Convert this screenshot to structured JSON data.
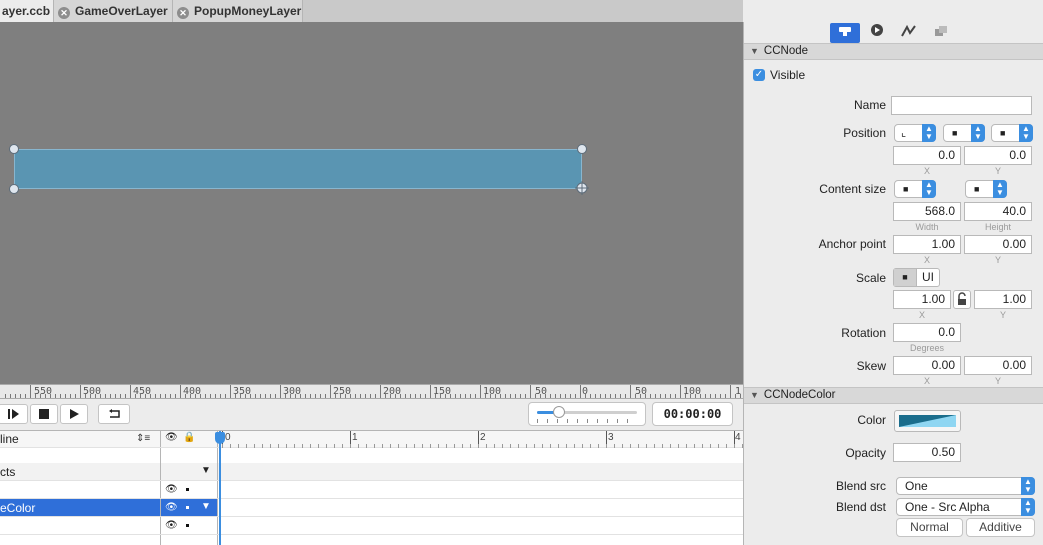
{
  "tabs": [
    {
      "label": "ayer.ccb",
      "active": true
    },
    {
      "label": "GameOverLayer",
      "active": false
    },
    {
      "label": "PopupMoneyLayer",
      "active": false
    }
  ],
  "ruler": {
    "labels": [
      "550",
      "500",
      "450",
      "400",
      "350",
      "300",
      "250",
      "200",
      "150",
      "100",
      "50",
      "0",
      "50",
      "100",
      "1"
    ]
  },
  "playback": {
    "timecode": "00:00:00",
    "zoom_fraction": 0.22
  },
  "timeline": {
    "header_label": "line",
    "ticks": [
      "0",
      "1",
      "2",
      "3",
      "4"
    ],
    "rows": [
      {
        "label": "",
        "kind": "blank"
      },
      {
        "label": "cts",
        "kind": "group"
      },
      {
        "label": "",
        "kind": "item"
      },
      {
        "label": "eColor",
        "kind": "selected"
      },
      {
        "label": "",
        "kind": "item"
      }
    ]
  },
  "inspector": {
    "tab_icons": [
      "node-properties-icon",
      "arrow-right-icon",
      "physics-icon",
      "layers-icon"
    ],
    "ccnode": {
      "title": "CCNode",
      "visible_label": "Visible",
      "name_label": "Name",
      "name_value": "",
      "position_label": "Position",
      "position_x": "0.0",
      "position_y": "0.0",
      "x_sub": "X",
      "y_sub": "Y",
      "content_size_label": "Content size",
      "width": "568.0",
      "height": "40.0",
      "width_sub": "Width",
      "height_sub": "Height",
      "anchor_label": "Anchor point",
      "anchor_x": "1.00",
      "anchor_y": "0.00",
      "scale_label": "Scale",
      "scale_seg_ui": "UI",
      "scale_x": "1.00",
      "scale_y": "1.00",
      "rotation_label": "Rotation",
      "rotation_value": "0.0",
      "degrees_sub": "Degrees",
      "skew_label": "Skew",
      "skew_x": "0.00",
      "skew_y": "0.00"
    },
    "ccnodecolor": {
      "title": "CCNodeColor",
      "color_label": "Color",
      "color_value": "#1a6d8c",
      "opacity_label": "Opacity",
      "opacity_value": "0.50",
      "blend_src_label": "Blend src",
      "blend_src_value": "One",
      "blend_dst_label": "Blend dst",
      "blend_dst_value": "One - Src Alpha",
      "normal_label": "Normal",
      "additive_label": "Additive"
    }
  }
}
